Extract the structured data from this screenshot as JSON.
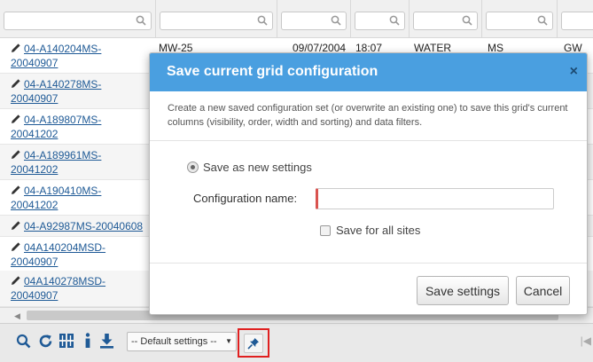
{
  "grid": {
    "filters": [
      {
        "id": "f1"
      },
      {
        "id": "f2"
      },
      {
        "id": "f3"
      },
      {
        "id": "f4"
      },
      {
        "id": "f5"
      },
      {
        "id": "f6"
      },
      {
        "id": "f7"
      }
    ],
    "rows": [
      {
        "id_line1": "04-A140204MS-",
        "id_line2": "20040907",
        "location": "MW-25",
        "date": "09/07/2004",
        "time": "18:07",
        "matrix": "WATER",
        "type": "MS",
        "extra": "GW"
      },
      {
        "id_line1": "04-A140278MS-",
        "id_line2": "20040907"
      },
      {
        "id_line1": "04-A189807MS-",
        "id_line2": "20041202"
      },
      {
        "id_line1": "04-A189961MS-",
        "id_line2": "20041202"
      },
      {
        "id_line1": "04-A190410MS-",
        "id_line2": "20041202"
      },
      {
        "id_line1": "04-A92987MS-20040608",
        "id_line2": ""
      },
      {
        "id_line1": "04A140204MSD-",
        "id_line2": "20040907"
      },
      {
        "id_line1": "04A140278MSD-",
        "id_line2": "20040907"
      }
    ]
  },
  "toolbar": {
    "settings_value": "-- Default settings --",
    "icons": [
      "search-icon",
      "refresh-icon",
      "columns-icon",
      "info-icon",
      "download-icon",
      "pin-icon"
    ]
  },
  "dialog": {
    "title": "Save current grid configuration",
    "close": "×",
    "description": "Create a new saved configuration set (or overwrite an existing one) to save this grid's current columns (visibility, order, width and sorting) and data filters.",
    "radio_label": "Save as new settings",
    "name_label": "Configuration name:",
    "name_value": "",
    "checkbox_label": "Save for all sites",
    "save_button": "Save settings",
    "cancel_button": "Cancel"
  },
  "colors": {
    "header_blue": "#4a9fe0",
    "link_blue": "#1f5a96",
    "highlight_red": "#e02020"
  }
}
